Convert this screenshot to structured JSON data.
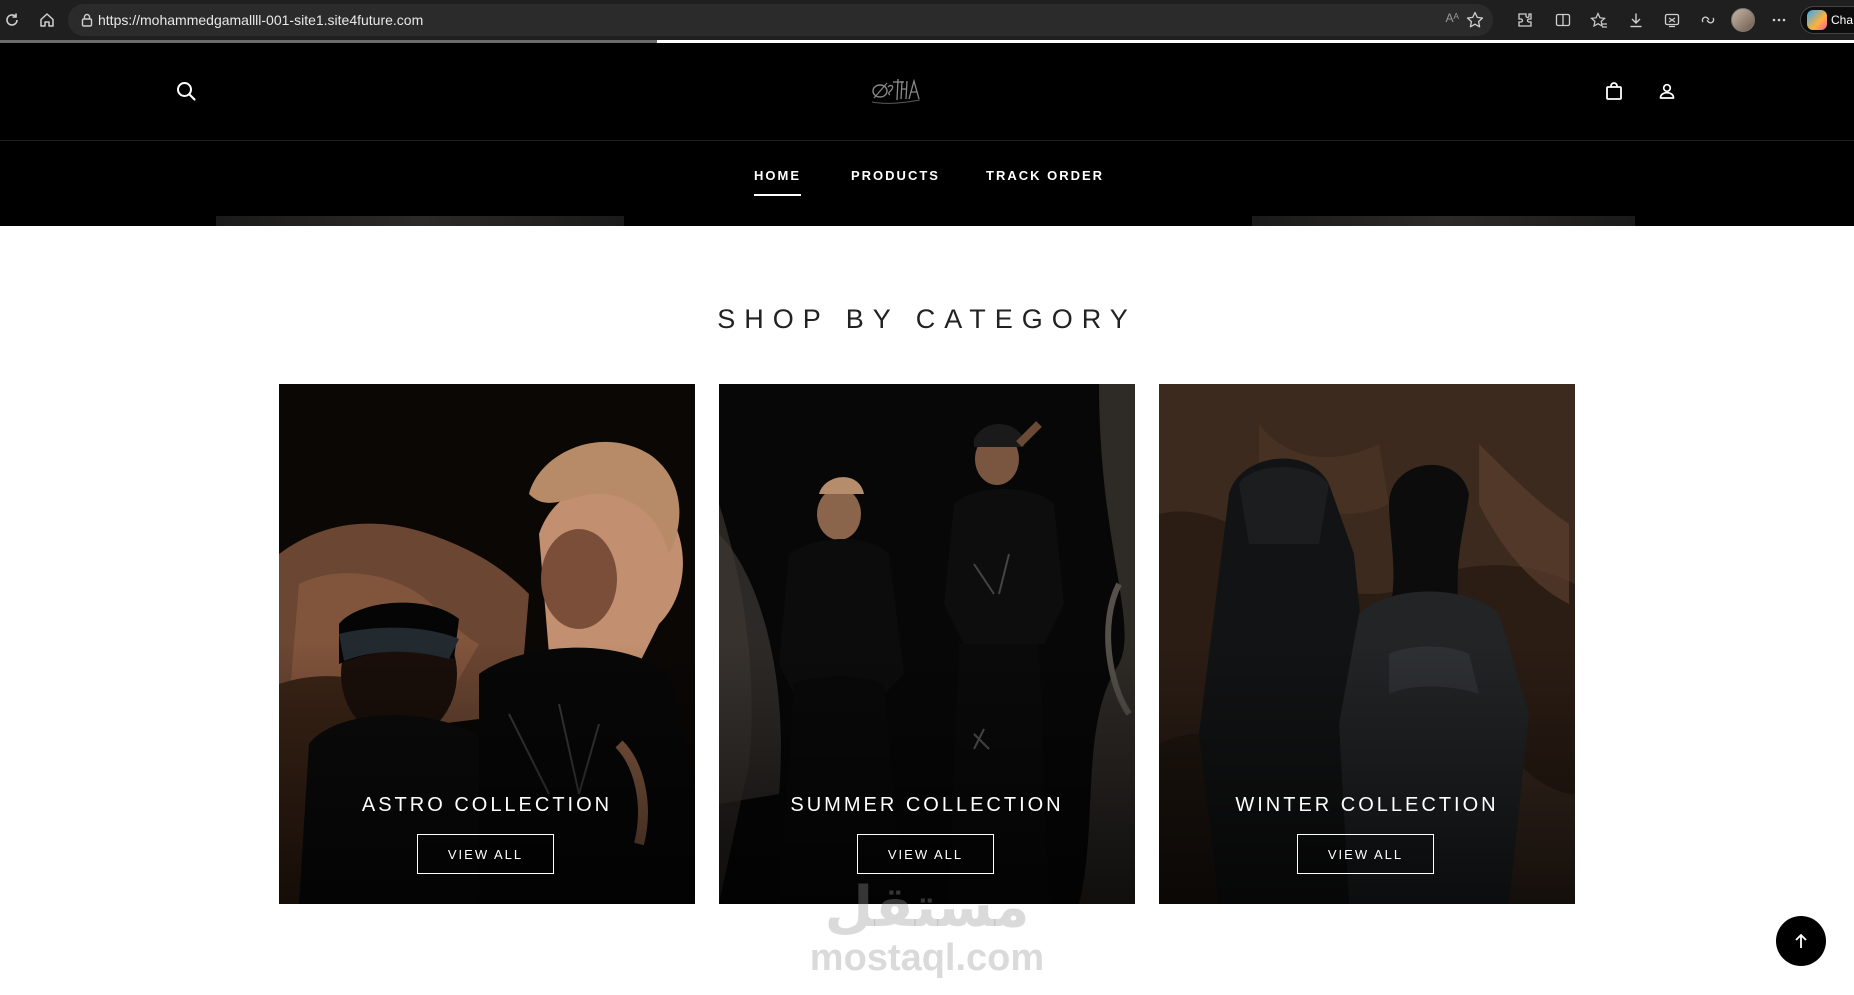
{
  "browser": {
    "url": "https://mohammedgamallll-001-site1.site4future.com",
    "read_aloud_label": "Aᴬ",
    "copilot_label": "Cha",
    "icons": [
      "refresh-icon",
      "home-icon",
      "lock-icon",
      "read-aloud-icon",
      "favorite-star-icon",
      "extensions-icon",
      "split-screen-icon",
      "favorites-icon",
      "downloads-icon",
      "screenshot-icon",
      "browser-essentials-icon",
      "profile-avatar",
      "more-icon",
      "copilot-icon"
    ]
  },
  "header": {
    "logo_text": "ØSTHA",
    "icons": [
      "search-icon",
      "shopping-bag-icon",
      "user-icon"
    ]
  },
  "nav": {
    "items": [
      {
        "label": "HOME",
        "active": true
      },
      {
        "label": "PRODUCTS",
        "active": false
      },
      {
        "label": "TRACK ORDER",
        "active": false
      }
    ]
  },
  "section": {
    "title": "SHOP BY CATEGORY"
  },
  "categories": [
    {
      "title": "ASTRO COLLECTION",
      "button": "VIEW ALL"
    },
    {
      "title": "SUMMER COLLECTION",
      "button": "VIEW ALL"
    },
    {
      "title": "WINTER COLLECTION",
      "button": "VIEW ALL"
    }
  ],
  "watermark": {
    "arabic": "مستقل",
    "latin": "mostaql.com"
  },
  "colors": {
    "header_bg": "#000000",
    "page_bg": "#ffffff",
    "title_text": "#222222",
    "browser_bg": "#1f1f1f"
  }
}
